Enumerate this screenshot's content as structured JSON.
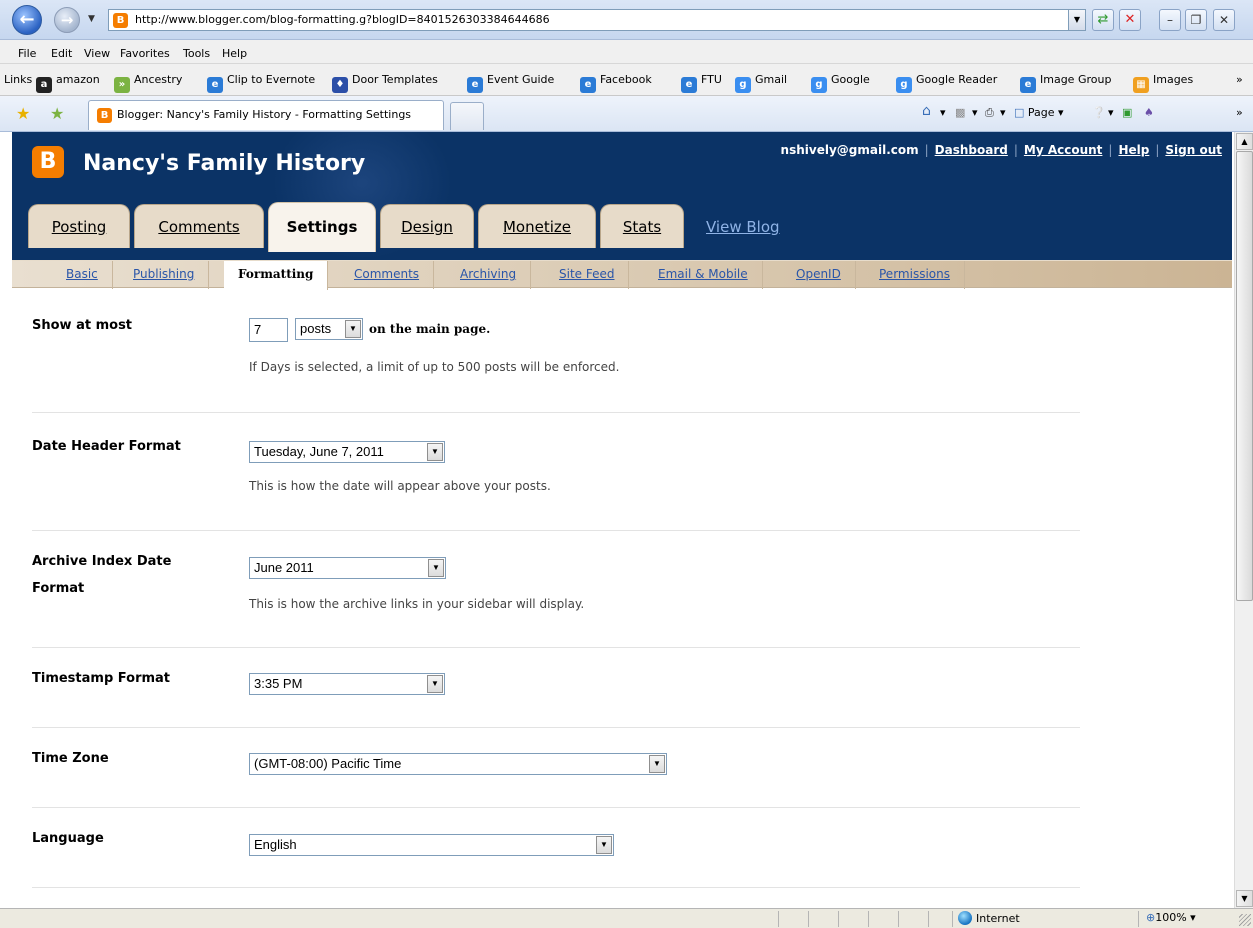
{
  "browser": {
    "url": "http://www.blogger.com/blog-formatting.g?blogID=8401526303384644686",
    "menu": [
      "File",
      "Edit",
      "View",
      "Favorites",
      "Tools",
      "Help"
    ],
    "links_label": "Links",
    "links": [
      {
        "label": "amazon",
        "icon": "amazon-icon",
        "color": "#222222"
      },
      {
        "label": "Ancestry",
        "icon": "ancestry-icon",
        "color": "#7cb342"
      },
      {
        "label": "Clip to Evernote",
        "icon": "ie-icon",
        "color": "#2b7bd6"
      },
      {
        "label": "Door Templates",
        "icon": "door-templates-icon",
        "color": "#2c4fa8"
      },
      {
        "label": "Event Guide",
        "icon": "ie-icon",
        "color": "#2b7bd6"
      },
      {
        "label": "Facebook",
        "icon": "ie-icon",
        "color": "#2b7bd6"
      },
      {
        "label": "FTU",
        "icon": "ie-icon",
        "color": "#2b7bd6"
      },
      {
        "label": "Gmail",
        "icon": "google-icon",
        "color": "#3a8ef0"
      },
      {
        "label": "Google",
        "icon": "google-icon",
        "color": "#3a8ef0"
      },
      {
        "label": "Google Reader",
        "icon": "google-icon",
        "color": "#3a8ef0"
      },
      {
        "label": "Image Group",
        "icon": "ie-icon",
        "color": "#2b7bd6"
      },
      {
        "label": "Images",
        "icon": "images-icon",
        "color": "#f0a020"
      }
    ],
    "tab_title": "Blogger: Nancy's Family History - Formatting Settings",
    "commands": {
      "page": "Page"
    },
    "status": {
      "zone": "Internet",
      "zoom": "100%"
    }
  },
  "blogger": {
    "blog_title": "Nancy's Family History",
    "user_email": "nshively@gmail.com",
    "user_links": [
      "Dashboard",
      "My Account",
      "Help",
      "Sign out"
    ],
    "main_tabs": [
      "Posting",
      "Comments",
      "Settings",
      "Design",
      "Monetize",
      "Stats"
    ],
    "active_main_tab": "Settings",
    "view_blog": "View Blog",
    "sub_tabs": [
      "Basic",
      "Publishing",
      "Formatting",
      "Comments",
      "Archiving",
      "Site Feed",
      "Email & Mobile",
      "OpenID",
      "Permissions"
    ],
    "active_sub_tab": "Formatting"
  },
  "settings": {
    "show_at_most": {
      "label": "Show at most",
      "value": "7",
      "unit": "posts",
      "suffix": "on the main page.",
      "help": "If Days is selected, a limit of up to 500 posts will be enforced."
    },
    "date_header": {
      "label": "Date Header Format",
      "value": "Tuesday, June 7, 2011",
      "help": "This is how the date will appear above your posts."
    },
    "archive_index": {
      "label_line1": "Archive Index Date",
      "label_line2": "Format",
      "value": "June 2011",
      "help": "This is how the archive links in your sidebar will display."
    },
    "timestamp": {
      "label": "Timestamp Format",
      "value": "3:35 PM"
    },
    "time_zone": {
      "label": "Time Zone",
      "value": "(GMT-08:00) Pacific Time"
    },
    "language": {
      "label": "Language",
      "value": "English"
    }
  }
}
